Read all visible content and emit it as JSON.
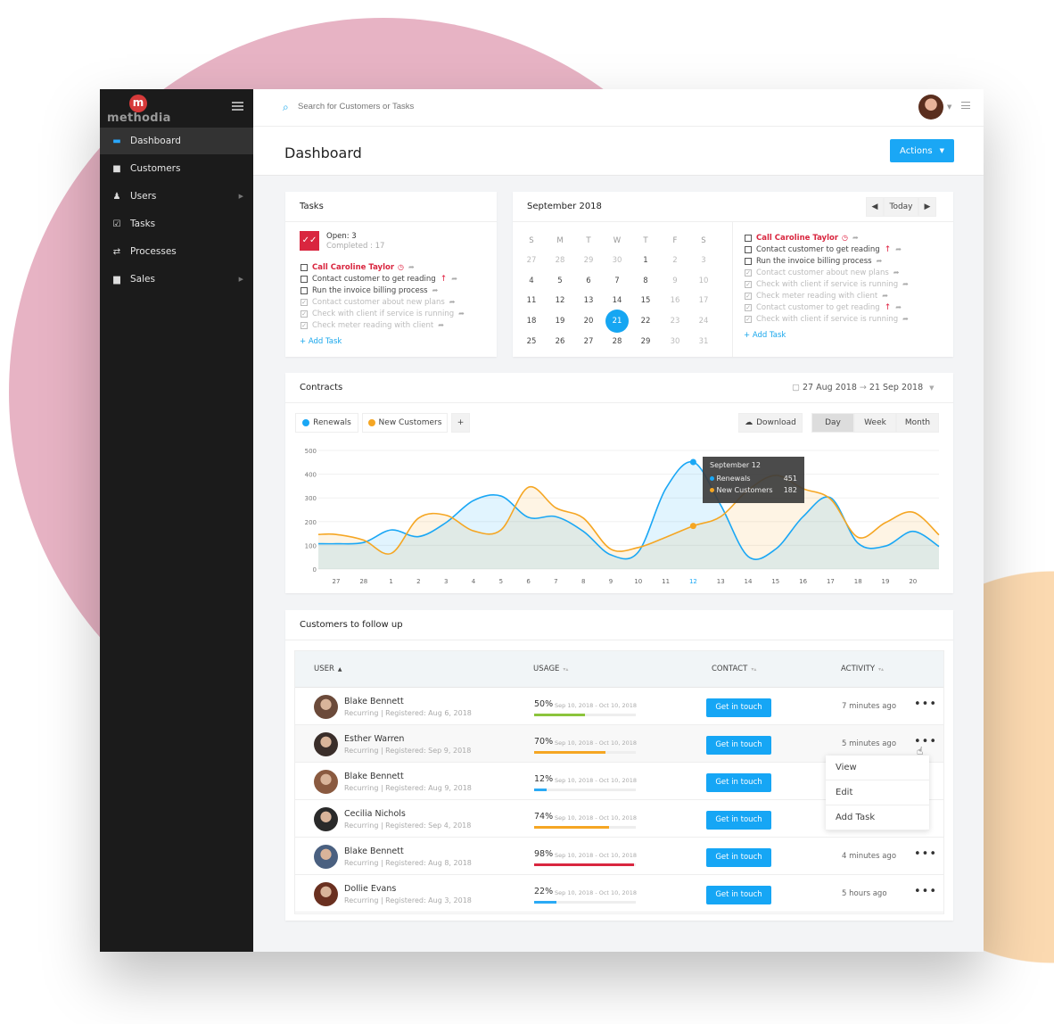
{
  "brand": {
    "name": "methodia",
    "letter": "m"
  },
  "sidebar": {
    "items": [
      {
        "label": "Dashboard",
        "icon": "dashboard-icon",
        "glyph": "▬",
        "active": true,
        "arrow": false
      },
      {
        "label": "Customers",
        "icon": "folder-icon",
        "glyph": "■",
        "active": false,
        "arrow": false
      },
      {
        "label": "Users",
        "icon": "user-icon",
        "glyph": "♟",
        "active": false,
        "arrow": true
      },
      {
        "label": "Tasks",
        "icon": "checkbox-icon",
        "glyph": "☑",
        "active": false,
        "arrow": false
      },
      {
        "label": "Processes",
        "icon": "process-icon",
        "glyph": "⇄",
        "active": false,
        "arrow": false
      },
      {
        "label": "Sales",
        "icon": "briefcase-icon",
        "glyph": "▆",
        "active": false,
        "arrow": true
      }
    ]
  },
  "search": {
    "placeholder": "Search for Customers or Tasks"
  },
  "header": {
    "title": "Dashboard",
    "actions_label": "Actions"
  },
  "tasks": {
    "title": "Tasks",
    "open": "Open: 3",
    "completed": "Completed : 17",
    "add_label": "Add Task",
    "items": [
      {
        "text": "Call Caroline Taylor",
        "done": false,
        "hot": true,
        "clock": true,
        "up": false
      },
      {
        "text": "Contact customer to get reading",
        "done": false,
        "hot": false,
        "clock": false,
        "up": true
      },
      {
        "text": "Run the invoice billing process",
        "done": false,
        "hot": false,
        "clock": false,
        "up": false
      },
      {
        "text": "Contact customer about new plans",
        "done": true,
        "hot": false,
        "clock": false,
        "up": false
      },
      {
        "text": "Check with client if service is running",
        "done": true,
        "hot": false,
        "clock": false,
        "up": false
      },
      {
        "text": "Check meter reading with client",
        "done": true,
        "hot": false,
        "clock": false,
        "up": false
      }
    ]
  },
  "calendar": {
    "title": "September 2018",
    "today_label": "Today",
    "selected": "21",
    "weekdays": [
      "S",
      "M",
      "T",
      "W",
      "T",
      "F",
      "S"
    ],
    "weeks": [
      [
        [
          "27",
          1
        ],
        [
          "28",
          1
        ],
        [
          "29",
          1
        ],
        [
          "30",
          1
        ],
        [
          "1",
          0
        ],
        [
          "2",
          1
        ],
        [
          "3",
          1
        ]
      ],
      [
        [
          "4",
          0
        ],
        [
          "5",
          0
        ],
        [
          "6",
          0
        ],
        [
          "7",
          0
        ],
        [
          "8",
          0
        ],
        [
          "9",
          1
        ],
        [
          "10",
          1
        ]
      ],
      [
        [
          "11",
          0
        ],
        [
          "12",
          0
        ],
        [
          "13",
          0
        ],
        [
          "14",
          0
        ],
        [
          "15",
          0
        ],
        [
          "16",
          1
        ],
        [
          "17",
          1
        ]
      ],
      [
        [
          "18",
          0
        ],
        [
          "19",
          0
        ],
        [
          "20",
          0
        ],
        [
          "21",
          0
        ],
        [
          "22",
          0
        ],
        [
          "23",
          1
        ],
        [
          "24",
          1
        ]
      ],
      [
        [
          "25",
          0
        ],
        [
          "26",
          0
        ],
        [
          "27",
          0
        ],
        [
          "28",
          0
        ],
        [
          "29",
          0
        ],
        [
          "30",
          1
        ],
        [
          "31",
          1
        ]
      ]
    ],
    "add_label": "Add Task",
    "tasks": [
      {
        "text": "Call Caroline Taylor",
        "done": false,
        "hot": true,
        "clock": true,
        "up": false
      },
      {
        "text": "Contact customer to get reading",
        "done": false,
        "hot": false,
        "clock": false,
        "up": true
      },
      {
        "text": "Run the invoice billing process",
        "done": false,
        "hot": false,
        "clock": false,
        "up": false
      },
      {
        "text": "Contact customer about new plans",
        "done": true,
        "hot": false,
        "clock": false,
        "up": false
      },
      {
        "text": "Check with client if service is running",
        "done": true,
        "hot": false,
        "clock": false,
        "up": false
      },
      {
        "text": "Check meter reading with client",
        "done": true,
        "hot": false,
        "clock": false,
        "up": false
      },
      {
        "text": "Contact customer to get reading",
        "done": true,
        "hot": false,
        "clock": false,
        "up": true
      },
      {
        "text": "Check with client if service is running",
        "done": true,
        "hot": false,
        "clock": false,
        "up": false
      }
    ]
  },
  "contracts": {
    "title": "Contracts",
    "date_from": "27 Aug 2018",
    "date_to": "21 Sep 2018",
    "legend": [
      {
        "label": "Renewals",
        "color": "#1aa7f5"
      },
      {
        "label": "New Customers",
        "color": "#f5a623"
      }
    ],
    "add_series": "+",
    "download": "Download",
    "periods": [
      "Day",
      "Week",
      "Month"
    ],
    "active_period": "Day",
    "tooltip": {
      "title": "September 12",
      "rows": [
        {
          "label": "Renewals",
          "value": "451"
        },
        {
          "label": "New Customers",
          "value": "182"
        }
      ]
    }
  },
  "chart_data": {
    "type": "area",
    "categories": [
      "27",
      "28",
      "1",
      "2",
      "3",
      "4",
      "5",
      "6",
      "7",
      "8",
      "9",
      "10",
      "11",
      "12",
      "13",
      "14",
      "15",
      "16",
      "17",
      "18",
      "19",
      "20"
    ],
    "highlight_category": "12",
    "ylim": [
      0,
      500
    ],
    "yticks": [
      0,
      100,
      200,
      300,
      400,
      500
    ],
    "grid": true,
    "series": [
      {
        "name": "Renewals",
        "color": "#1aa7f5",
        "values": [
          107,
          112,
          165,
          137,
          196,
          289,
          308,
          218,
          221,
          159,
          60,
          72,
          339,
          451,
          270,
          53,
          84,
          221,
          301,
          109,
          97,
          159
        ]
      },
      {
        "name": "New Customers",
        "color": "#f5a623",
        "values": [
          146,
          122,
          66,
          215,
          227,
          161,
          165,
          345,
          258,
          215,
          84,
          91,
          134,
          182,
          221,
          333,
          395,
          339,
          295,
          134,
          196,
          240
        ]
      }
    ]
  },
  "followup": {
    "title": "Customers to follow up",
    "columns": [
      "USER",
      "USAGE",
      "CONTACT",
      "ACTIVITY"
    ],
    "button_label": "Get in touch",
    "rows": [
      {
        "name": "Blake Bennett",
        "sub": "Recurring | Registered: Aug 6, 2018",
        "usage": "50%",
        "pct": 50,
        "range": "Sep 10, 2018 - Oct 10, 2018",
        "color": "#8cc43c",
        "activity": "7 minutes ago"
      },
      {
        "name": "Esther Warren",
        "sub": "Recurring | Registered: Sep 9, 2018",
        "usage": "70%",
        "pct": 70,
        "range": "Sep 10, 2018 - Oct 10, 2018",
        "color": "#f5a623",
        "activity": "5 minutes ago"
      },
      {
        "name": "Blake Bennett",
        "sub": "Recurring | Registered: Aug 9, 2018",
        "usage": "12%",
        "pct": 12,
        "range": "Sep 10, 2018 - Oct 10, 2018",
        "color": "#2aaaf5",
        "activity": ""
      },
      {
        "name": "Cecilia Nichols",
        "sub": "Recurring | Registered: Sep 4, 2018",
        "usage": "74%",
        "pct": 74,
        "range": "Sep 10, 2018 - Oct 10, 2018",
        "color": "#f5a623",
        "activity": ""
      },
      {
        "name": "Blake Bennett",
        "sub": "Recurring | Registered: Aug 8, 2018",
        "usage": "98%",
        "pct": 98,
        "range": "Sep 10, 2018 - Oct 10, 2018",
        "color": "#d9263f",
        "activity": "4 minutes ago"
      },
      {
        "name": "Dollie Evans",
        "sub": "Recurring | Registered: Aug 3, 2018",
        "usage": "22%",
        "pct": 22,
        "range": "Sep 10, 2018 - Oct 10, 2018",
        "color": "#2aaaf5",
        "activity": "5 hours ago"
      }
    ],
    "menu": [
      "View",
      "Edit",
      "Add Task"
    ]
  }
}
